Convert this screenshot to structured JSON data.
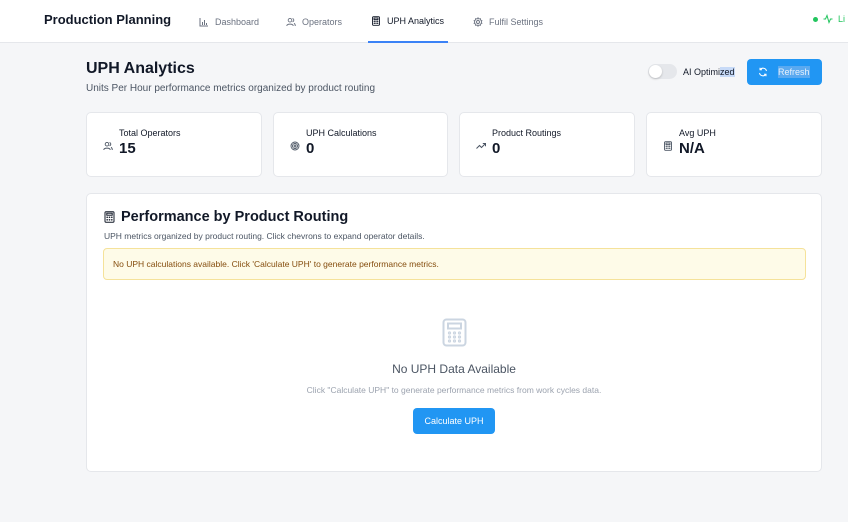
{
  "nav": {
    "app_title": "Production Planning",
    "items": [
      {
        "label": "Dashboard",
        "icon": "bar-chart-icon"
      },
      {
        "label": "Operators",
        "icon": "users-icon"
      },
      {
        "label": "UPH Analytics",
        "icon": "calculator-icon",
        "active": true
      },
      {
        "label": "Fulfil Settings",
        "icon": "gear-icon"
      }
    ],
    "live_label": "Li"
  },
  "header": {
    "title": "UPH Analytics",
    "subtitle": "Units Per Hour performance metrics organized by product routing",
    "toggle_label_a": "AI Optimi",
    "toggle_label_b": "zed",
    "ai_optimized_on": false,
    "refresh_label": "Refresh"
  },
  "stats": [
    {
      "label": "Total Operators",
      "value": "15",
      "icon": "users-icon"
    },
    {
      "label": "UPH Calculations",
      "value": "0",
      "icon": "target-icon"
    },
    {
      "label": "Product Routings",
      "value": "0",
      "icon": "trending-up-icon"
    },
    {
      "label": "Avg UPH",
      "value": "N/A",
      "icon": "calculator-icon"
    }
  ],
  "panel": {
    "title": "Performance by Product Routing",
    "description": "UPH metrics organized by product routing. Click chevrons to expand operator details.",
    "alert": "No UPH calculations available. Click 'Calculate UPH' to generate performance metrics.",
    "empty_title": "No UPH Data Available",
    "empty_description": "Click \"Calculate UPH\" to generate performance metrics from work cycles data.",
    "calculate_label": "Calculate UPH"
  },
  "colors": {
    "accent": "#2196f3",
    "live": "#22c55e",
    "alert_bg": "#fefbe8",
    "alert_text": "#854d0e"
  }
}
